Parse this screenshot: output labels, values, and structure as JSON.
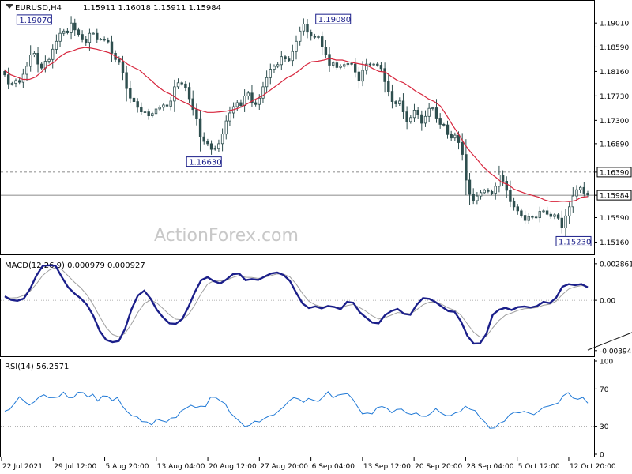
{
  "header": {
    "symbol": "EURUSD,H4",
    "ohlc": "1.15911 1.16018 1.15911 1.15984"
  },
  "watermark": "ActionForex.com",
  "colors": {
    "candle": "#2f4f4f",
    "sma": "#d7263d",
    "macd": "#1b1f8a",
    "signal": "#a0a0a0",
    "rsi": "#1e78d6",
    "trendline": "#111111",
    "ref_lines": "#666666",
    "box_text": "#1b1f8a"
  },
  "chart_data": [
    {
      "id": "price",
      "type": "line",
      "title": "EURUSD,H4",
      "ylim": [
        1.15,
        1.1936
      ],
      "yticks": [
        "1.19010",
        "1.18590",
        "1.18160",
        "1.17730",
        "1.17300",
        "1.16890",
        "1.16390",
        "1.15984",
        "1.15590",
        "1.15160"
      ],
      "ytick_values": [
        1.1901,
        1.1859,
        1.1816,
        1.1773,
        1.173,
        1.1689,
        1.1639,
        1.15984,
        1.1559,
        1.1516
      ],
      "highlight_ticks": [
        "1.16390",
        "1.15984"
      ],
      "reference_lines": [
        {
          "value": 1.1639,
          "style": "dashed"
        },
        {
          "value": 1.15984,
          "style": "solid"
        }
      ],
      "annotations": [
        {
          "text": "1.19070",
          "x": 8,
          "value": 1.1907
        },
        {
          "text": "1.16630",
          "x": 54,
          "value": 1.1663
        },
        {
          "text": "1.19080",
          "x": 89,
          "value": 1.1908
        },
        {
          "text": "1.15230",
          "x": 170,
          "value": 1.1523
        }
      ],
      "series": [
        {
          "kind": "candles",
          "closes": [
            1.181,
            1.1794,
            1.1795,
            1.18,
            1.1797,
            1.1811,
            1.1825,
            1.1845,
            1.1848,
            1.1829,
            1.1822,
            1.1834,
            1.1837,
            1.1855,
            1.1869,
            1.1883,
            1.1887,
            1.1884,
            1.1901,
            1.1889,
            1.1881,
            1.1873,
            1.1867,
            1.1883,
            1.1883,
            1.1873,
            1.1873,
            1.1871,
            1.1868,
            1.1848,
            1.1837,
            1.1832,
            1.1814,
            1.1786,
            1.1769,
            1.1763,
            1.1753,
            1.1745,
            1.1745,
            1.1738,
            1.1742,
            1.175,
            1.1753,
            1.1757,
            1.1755,
            1.1764,
            1.1789,
            1.1796,
            1.1794,
            1.1788,
            1.1768,
            1.1749,
            1.1733,
            1.1701,
            1.1693,
            1.1689,
            1.1679,
            1.1681,
            1.1689,
            1.1706,
            1.1729,
            1.1743,
            1.1754,
            1.1761,
            1.1756,
            1.1773,
            1.1778,
            1.1761,
            1.1758,
            1.1769,
            1.1789,
            1.1805,
            1.182,
            1.1825,
            1.1828,
            1.1842,
            1.1838,
            1.1835,
            1.1851,
            1.1869,
            1.1887,
            1.1899,
            1.1885,
            1.1878,
            1.1876,
            1.1877,
            1.1859,
            1.1846,
            1.1827,
            1.1831,
            1.1823,
            1.1825,
            1.1828,
            1.183,
            1.1829,
            1.1815,
            1.1799,
            1.1818,
            1.1829,
            1.1828,
            1.1829,
            1.1827,
            1.1821,
            1.1798,
            1.1781,
            1.1763,
            1.1759,
            1.1764,
            1.1745,
            1.1728,
            1.1735,
            1.1748,
            1.174,
            1.1725,
            1.1737,
            1.1751,
            1.1752,
            1.1734,
            1.1723,
            1.1722,
            1.1705,
            1.1699,
            1.1704,
            1.1691,
            1.167,
            1.1625,
            1.16,
            1.1589,
            1.1597,
            1.1603,
            1.1607,
            1.1605,
            1.1602,
            1.1614,
            1.1634,
            1.1623,
            1.1607,
            1.1587,
            1.1578,
            1.1571,
            1.1563,
            1.1554,
            1.1561,
            1.156,
            1.1559,
            1.157,
            1.1571,
            1.1565,
            1.1561,
            1.1564,
            1.1558,
            1.1541,
            1.1562,
            1.1578,
            1.1597,
            1.1608,
            1.1612,
            1.1602,
            1.1599
          ]
        },
        {
          "kind": "moving-average",
          "values": [
            1.1818,
            1.181,
            1.1806,
            1.1802,
            1.1802,
            1.1806,
            1.1815,
            1.1826,
            1.1832,
            1.1842,
            1.1849,
            1.1852,
            1.1856,
            1.1858,
            1.1857,
            1.1855,
            1.1852,
            1.1849,
            1.1843,
            1.1837,
            1.1829,
            1.1823,
            1.1818,
            1.1808,
            1.1799,
            1.1789,
            1.1781,
            1.1776,
            1.1769,
            1.1763,
            1.1758,
            1.1751,
            1.1747,
            1.1744,
            1.1744,
            1.1745,
            1.1746,
            1.1748,
            1.1751,
            1.1756,
            1.1762,
            1.1768,
            1.1773,
            1.1781,
            1.1789,
            1.1797,
            1.1805,
            1.181,
            1.1818,
            1.1827,
            1.1833,
            1.1834,
            1.1836,
            1.1839,
            1.1836,
            1.1836,
            1.1833,
            1.1831,
            1.1829,
            1.1827,
            1.1821,
            1.1816,
            1.1815,
            1.1807,
            1.18,
            1.1796,
            1.1789,
            1.1781,
            1.1775,
            1.1768,
            1.1763,
            1.1755,
            1.1739,
            1.1721,
            1.1705,
            1.1687,
            1.1673,
            1.1661,
            1.1648,
            1.1638,
            1.163,
            1.1621,
            1.1617,
            1.1609,
            1.1605,
            1.1601,
            1.1598,
            1.1595,
            1.159,
            1.1587,
            1.1587,
            1.1588,
            1.1587,
            1.1589,
            1.1595,
            1.1596
          ]
        }
      ]
    },
    {
      "id": "macd",
      "type": "line",
      "title": "MACD(12,26,9) 0.000979 0.000927",
      "ylim": [
        -0.0042,
        0.0031
      ],
      "yticks": [
        "0.002861",
        "0.00",
        "-0.00394"
      ],
      "ytick_values": [
        0.002861,
        0.0,
        -0.00394
      ],
      "reference_lines": [
        {
          "value": 0.0,
          "style": "dotted"
        }
      ],
      "series": [
        {
          "name": "macd",
          "values": [
            0.00031,
            3e-05,
            -4e-05,
            0.00013,
            0.00089,
            0.00194,
            0.00269,
            0.00274,
            0.00271,
            0.00182,
            0.00102,
            0.00054,
            0.00014,
            -0.00037,
            -0.00124,
            -0.00241,
            -0.00309,
            -0.00327,
            -0.00319,
            -0.00222,
            -0.00071,
            0.00037,
            0.00075,
            0.00014,
            -0.00074,
            -0.00135,
            -0.00181,
            -0.00184,
            -0.00147,
            -0.00051,
            0.00065,
            0.00158,
            0.00181,
            0.0015,
            0.00131,
            0.00164,
            0.00204,
            0.00209,
            0.00157,
            0.00166,
            0.00159,
            0.00185,
            0.00209,
            0.00217,
            0.00198,
            0.00151,
            0.00059,
            -0.00025,
            -0.00061,
            -0.00048,
            -0.00063,
            -0.00045,
            -0.00052,
            -0.0007,
            -0.00013,
            -0.00019,
            -0.00093,
            -0.00134,
            -0.00175,
            -0.00181,
            -0.00117,
            -0.00085,
            -0.00068,
            -0.00106,
            -0.00113,
            -0.00036,
            0.00017,
            0.00011,
            -0.00015,
            -0.00051,
            -0.00085,
            -0.0009,
            -0.00167,
            -0.00278,
            -0.00339,
            -0.00337,
            -0.00262,
            -0.00113,
            -0.00074,
            -0.00059,
            -0.00076,
            -0.00053,
            -0.00049,
            -0.00057,
            -0.00045,
            -0.00013,
            -0.00022,
            0.00019,
            0.00106,
            0.00126,
            0.00119,
            0.00127,
            0.00101
          ]
        },
        {
          "name": "signal",
          "values": [
            0.00021,
            0.00018,
            0.00021,
            0.00039,
            0.00072,
            0.00128,
            0.00195,
            0.00236,
            0.00256,
            0.00241,
            0.00192,
            0.00142,
            0.00097,
            0.0004,
            -0.00037,
            -0.00129,
            -0.00212,
            -0.00268,
            -0.00286,
            -0.00259,
            -0.00185,
            -0.00095,
            -0.00026,
            2e-05,
            -0.00021,
            -0.00066,
            -0.00114,
            -0.00148,
            -0.00153,
            -0.00112,
            -0.00036,
            0.00053,
            0.00126,
            0.00153,
            0.00151,
            0.00158,
            0.00179,
            0.00194,
            0.0018,
            0.00178,
            0.00171,
            0.0018,
            0.00194,
            0.00206,
            0.00204,
            0.00183,
            0.00126,
            0.00052,
            -8e-05,
            -0.00036,
            -0.00051,
            -0.0005,
            -0.00052,
            -0.0006,
            -0.00042,
            -0.00032,
            -0.00057,
            -0.00086,
            -0.00122,
            -0.00147,
            -0.00136,
            -0.00116,
            -0.00096,
            -0.001,
            -0.00106,
            -0.00075,
            -0.00035,
            -0.00015,
            -0.00015,
            -0.00033,
            -0.0006,
            -0.00078,
            -0.00117,
            -0.00185,
            -0.0025,
            -0.00288,
            -0.00281,
            -0.00216,
            -0.00158,
            -0.00117,
            -0.00099,
            -0.00079,
            -0.00066,
            -0.00063,
            -0.00057,
            -0.00039,
            -0.00031,
            -8e-05,
            0.00046,
            0.00088,
            0.00105,
            0.00115,
            0.00109
          ]
        }
      ],
      "trendline": [
        {
          "x": 158,
          "value": -0.0039
        },
        {
          "x": 192,
          "value": 0.0
        }
      ]
    },
    {
      "id": "rsi",
      "type": "line",
      "title": "RSI(14) 56.2571",
      "ylim": [
        0,
        100
      ],
      "yticks": [
        "100",
        "70",
        "30",
        "0"
      ],
      "ytick_values": [
        100,
        70,
        30,
        0
      ],
      "reference_lines": [
        {
          "value": 70,
          "style": "dotted"
        },
        {
          "value": 30,
          "style": "dotted"
        }
      ],
      "series": [
        {
          "name": "rsi",
          "values": [
            46.2,
            48.1,
            54.6,
            61.6,
            56.8,
            52.7,
            56.0,
            61.3,
            63.8,
            60.7,
            60.8,
            61.4,
            66.6,
            60.8,
            60.7,
            66.5,
            66.1,
            61.2,
            64.4,
            57.0,
            62.6,
            62.2,
            57.5,
            60.9,
            51.9,
            45.5,
            41.2,
            40.3,
            35.1,
            34.7,
            31.5,
            37.7,
            36.0,
            34.6,
            38.9,
            39.4,
            46.4,
            49.4,
            52.6,
            50.2,
            51.6,
            51.2,
            61.3,
            61.0,
            57.4,
            54.2,
            44.4,
            39.5,
            34.9,
            29.7,
            31.1,
            35.4,
            34.7,
            38.4,
            41.1,
            42.3,
            46.9,
            51.1,
            57.2,
            60.8,
            59.2,
            55.8,
            59.9,
            58.0,
            56.6,
            61.6,
            67.0,
            60.6,
            63.5,
            64.4,
            65.0,
            59.4,
            51.2,
            43.3,
            44.3,
            43.3,
            50.1,
            51.3,
            49.4,
            44.5,
            48.1,
            48.5,
            44.2,
            42.7,
            44.3,
            40.9,
            40.6,
            43.7,
            49.0,
            44.4,
            41.5,
            41.4,
            44.5,
            45.8,
            51.6,
            48.2,
            46.8,
            39.3,
            34.6,
            27.8,
            28.1,
            33.3,
            35.4,
            42.1,
            45.1,
            44.4,
            45.9,
            44.2,
            42.4,
            46.3,
            50.5,
            51.7,
            53.2,
            55.1,
            62.7,
            66.1,
            60.3,
            59.1,
            61.0,
            54.8
          ]
        }
      ]
    }
  ],
  "x_axis": {
    "labels": [
      "22 Jul 2021",
      "29 Jul 12:00",
      "5 Aug 20:00",
      "13 Aug 04:00",
      "20 Aug 12:00",
      "27 Aug 20:00",
      "6 Sep 04:00",
      "13 Sep 12:00",
      "20 Sep 20:00",
      "28 Sep 04:00",
      "5 Oct 12:00",
      "12 Oct 20:00"
    ]
  }
}
